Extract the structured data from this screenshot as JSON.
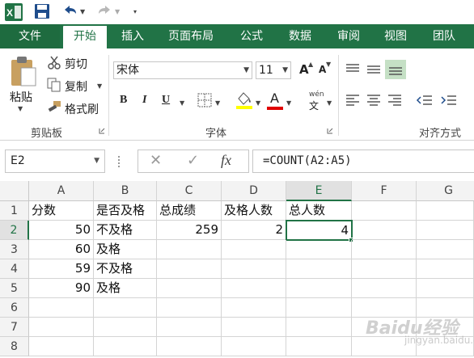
{
  "tabs": {
    "file": "文件",
    "home": "开始",
    "insert": "插入",
    "page_layout": "页面布局",
    "formulas": "公式",
    "data": "数据",
    "review": "审阅",
    "view": "视图",
    "team": "团队"
  },
  "clipboard": {
    "paste": "粘贴",
    "cut": "剪切",
    "copy": "复制",
    "format_painter": "格式刷",
    "group_label": "剪贴板"
  },
  "font": {
    "name": "宋体",
    "size": "11",
    "bold": "B",
    "italic": "I",
    "underline": "U",
    "font_color_letter": "A",
    "wen": "wén",
    "wen_char": "文",
    "grow": "A",
    "shrink": "A",
    "group_label": "字体"
  },
  "alignment": {
    "group_label": "对齐方式"
  },
  "formula_bar": {
    "name_box": "E2",
    "cancel": "✕",
    "enter": "✓",
    "fx": "fx",
    "formula": "=COUNT(A2:A5)"
  },
  "grid": {
    "columns": [
      "A",
      "B",
      "C",
      "D",
      "E",
      "F",
      "G"
    ],
    "rows": [
      "1",
      "2",
      "3",
      "4",
      "5",
      "6",
      "7",
      "8"
    ],
    "cells": {
      "A1": "分数",
      "B1": "是否及格",
      "C1": "总成绩",
      "D1": "及格人数",
      "E1": "总人数",
      "A2": "50",
      "B2": "不及格",
      "C2": "259",
      "D2": "2",
      "E2": "4",
      "A3": "60",
      "B3": "及格",
      "A4": "59",
      "B4": "不及格",
      "A5": "90",
      "B5": "及格"
    }
  },
  "colors": {
    "accent": "#217346",
    "header_bg": "#f3f3f3",
    "gridline": "#d4d4d4",
    "underline_yellow": "#ffff00",
    "font_red": "#e00000"
  },
  "watermark": {
    "brand": "Baidu经验",
    "sub": "jingyan.baidu.com"
  }
}
